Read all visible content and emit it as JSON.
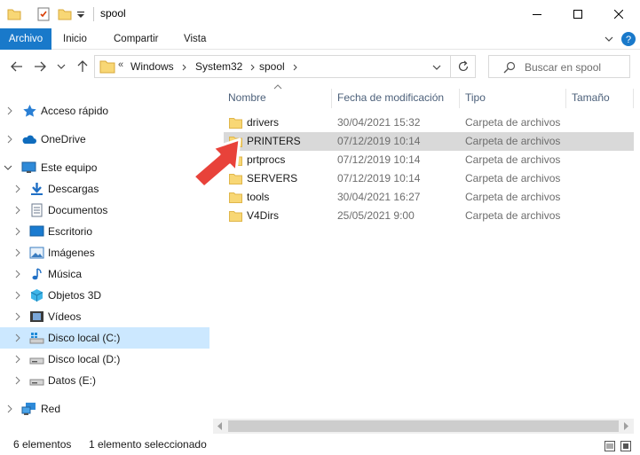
{
  "window": {
    "title": "spool",
    "controls": [
      "minimize",
      "maximize",
      "close"
    ]
  },
  "ribbon": {
    "tabs": [
      "Archivo",
      "Inicio",
      "Compartir",
      "Vista"
    ]
  },
  "address": {
    "overflow": "«",
    "crumbs": [
      "Windows",
      "System32",
      "spool"
    ]
  },
  "search": {
    "placeholder": "Buscar en spool"
  },
  "nav": {
    "items": [
      {
        "label": "Acceso rápido",
        "icon": "star-icon"
      },
      {
        "label": "OneDrive",
        "icon": "cloud-icon"
      },
      {
        "label": "Este equipo",
        "icon": "computer-icon"
      },
      {
        "label": "Descargas",
        "icon": "download-icon"
      },
      {
        "label": "Documentos",
        "icon": "document-icon"
      },
      {
        "label": "Escritorio",
        "icon": "desktop-icon"
      },
      {
        "label": "Imágenes",
        "icon": "pictures-icon"
      },
      {
        "label": "Música",
        "icon": "music-icon"
      },
      {
        "label": "Objetos 3D",
        "icon": "cube-icon"
      },
      {
        "label": "Vídeos",
        "icon": "video-icon"
      },
      {
        "label": "Disco local (C:)",
        "icon": "windows-drive-icon",
        "selected": true
      },
      {
        "label": "Disco local (D:)",
        "icon": "drive-icon"
      },
      {
        "label": "Datos (E:)",
        "icon": "drive-icon"
      },
      {
        "label": "Red",
        "icon": "network-icon"
      }
    ]
  },
  "columns": [
    "Nombre",
    "Fecha de modificación",
    "Tipo",
    "Tamaño"
  ],
  "files": [
    {
      "name": "drivers",
      "date": "30/04/2021 15:32",
      "type": "Carpeta de archivos"
    },
    {
      "name": "PRINTERS",
      "date": "07/12/2019 10:14",
      "type": "Carpeta de archivos",
      "selected": true
    },
    {
      "name": "prtprocs",
      "date": "07/12/2019 10:14",
      "type": "Carpeta de archivos"
    },
    {
      "name": "SERVERS",
      "date": "07/12/2019 10:14",
      "type": "Carpeta de archivos"
    },
    {
      "name": "tools",
      "date": "30/04/2021 16:27",
      "type": "Carpeta de archivos"
    },
    {
      "name": "V4Dirs",
      "date": "25/05/2021 9:00",
      "type": "Carpeta de archivos"
    }
  ],
  "status": {
    "count": "6 elementos",
    "selection": "1 elemento seleccionado"
  },
  "colors": {
    "file_tab": "#1979ca",
    "nav_selected": "#cce8ff",
    "row_selected": "#d9d9d9",
    "folder": "#f8d775",
    "arrow": "#e8423a"
  }
}
